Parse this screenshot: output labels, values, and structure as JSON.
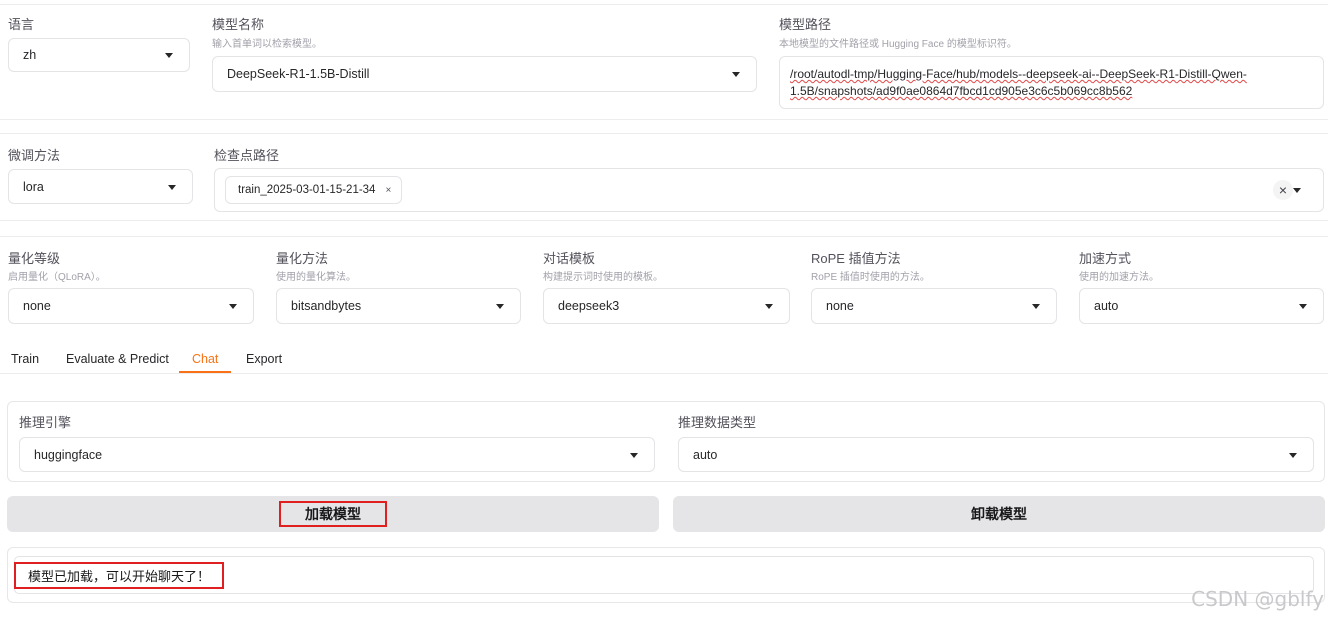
{
  "row1": {
    "language": {
      "label": "语言",
      "value": "zh"
    },
    "model_name": {
      "label": "模型名称",
      "hint": "输入首单词以检索模型。",
      "value": "DeepSeek-R1-1.5B-Distill"
    },
    "model_path": {
      "label": "模型路径",
      "hint": "本地模型的文件路径或 Hugging Face 的模型标识符。",
      "line1": "/root/autodl-tmp/Hugging-Face/hub/models--deepseek-ai--DeepSeek-R1-Distill-Qwen-",
      "line2": "1.5B/snapshots/ad9f0ae0864d7fbcd1cd905e3c6c5b069cc8b562"
    }
  },
  "row2": {
    "finetune": {
      "label": "微调方法",
      "value": "lora"
    },
    "checkpoint": {
      "label": "检查点路径",
      "chip": "train_2025-03-01-15-21-34",
      "chip_remove": "×",
      "clear": "×"
    }
  },
  "row3": {
    "quant_bit": {
      "label": "量化等级",
      "hint": "启用量化（QLoRA）。",
      "value": "none"
    },
    "quant_method": {
      "label": "量化方法",
      "hint": "使用的量化算法。",
      "value": "bitsandbytes"
    },
    "template": {
      "label": "对话模板",
      "hint": "构建提示词时使用的模板。",
      "value": "deepseek3"
    },
    "rope": {
      "label": "RoPE 插值方法",
      "hint": "RoPE 插值时使用的方法。",
      "value": "none"
    },
    "booster": {
      "label": "加速方式",
      "hint": "使用的加速方法。",
      "value": "auto"
    }
  },
  "tabs": [
    {
      "label": "Train",
      "active": false
    },
    {
      "label": "Evaluate & Predict",
      "active": false
    },
    {
      "label": "Chat",
      "active": true
    },
    {
      "label": "Export",
      "active": false
    }
  ],
  "chat": {
    "infer_backend": {
      "label": "推理引擎",
      "value": "huggingface"
    },
    "infer_dtype": {
      "label": "推理数据类型",
      "value": "auto"
    },
    "load_button": "加载模型",
    "unload_button": "卸载模型",
    "status_text": "模型已加载，可以开始聊天了！"
  },
  "watermark": "CSDN @gblfy",
  "colors": {
    "accent": "#f97316",
    "highlight_box": "#e02020",
    "button_bg": "#e5e5e7"
  }
}
